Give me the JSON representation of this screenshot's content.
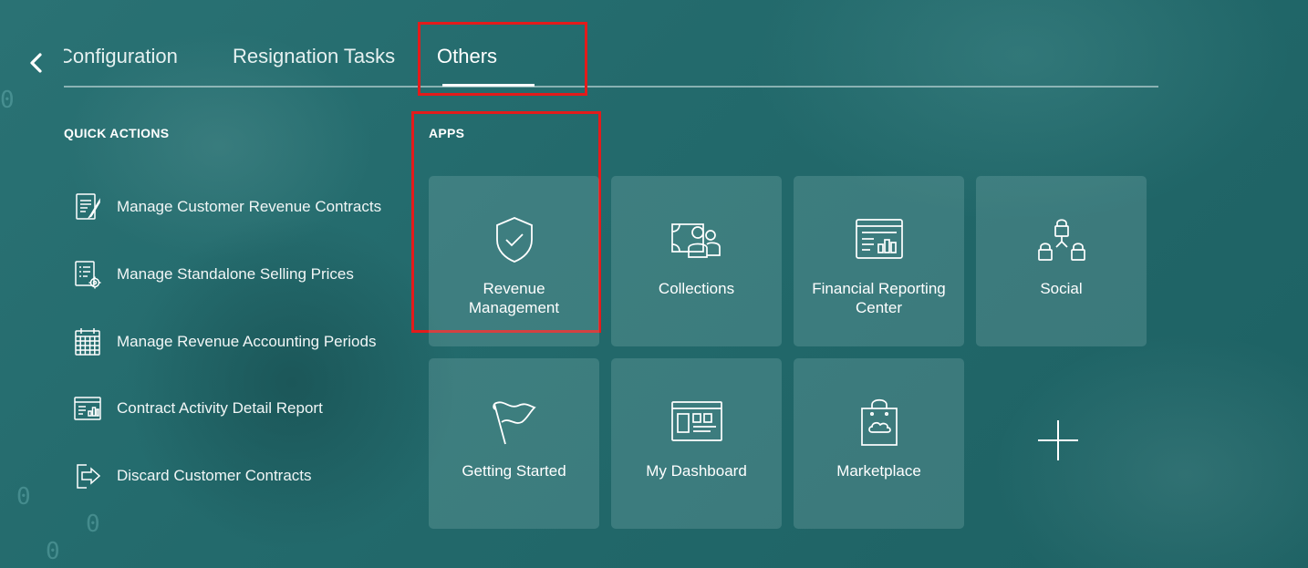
{
  "tabs": [
    {
      "label": "Configuration"
    },
    {
      "label": "Resignation Tasks"
    },
    {
      "label": "Others"
    }
  ],
  "quick_actions": {
    "title": "QUICK ACTIONS",
    "items": [
      {
        "label": "Manage Customer Revenue Contracts",
        "icon": "contract-document-icon"
      },
      {
        "label": "Manage Standalone Selling Prices",
        "icon": "list-settings-icon"
      },
      {
        "label": "Manage Revenue Accounting Periods",
        "icon": "calendar-icon"
      },
      {
        "label": "Contract Activity Detail Report",
        "icon": "report-chart-icon"
      },
      {
        "label": "Discard Customer Contracts",
        "icon": "exit-document-icon"
      }
    ]
  },
  "apps": {
    "title": "APPS",
    "tiles": [
      {
        "label": "Revenue Management",
        "icon": "shield-check-icon"
      },
      {
        "label": "Collections",
        "icon": "people-money-icon"
      },
      {
        "label": "Financial Reporting Center",
        "icon": "report-window-icon"
      },
      {
        "label": "Social",
        "icon": "social-network-icon"
      },
      {
        "label": "Getting Started",
        "icon": "flag-icon"
      },
      {
        "label": "My Dashboard",
        "icon": "dashboard-icon"
      },
      {
        "label": "Marketplace",
        "icon": "shopping-bag-icon"
      }
    ]
  },
  "colors": {
    "background": "#1f6466",
    "highlight": "#e31b1b",
    "tile": "rgba(160,200,200,0.22)"
  }
}
